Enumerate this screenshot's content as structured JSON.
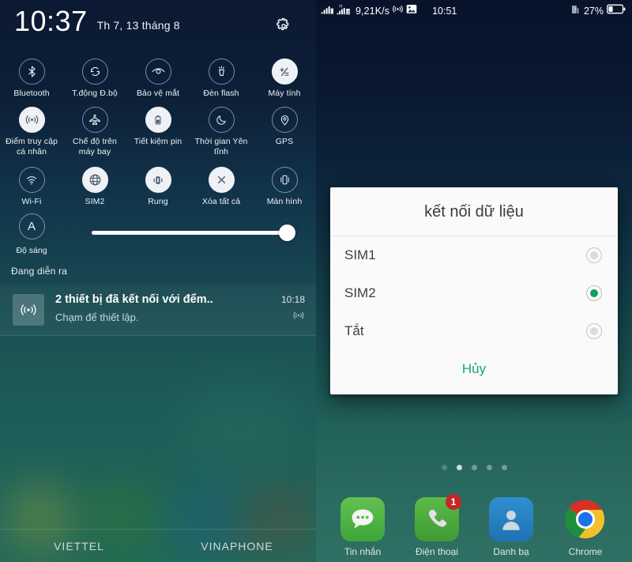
{
  "left_panel": {
    "clock": {
      "time": "10:37",
      "date": "Th 7, 13 tháng 8"
    },
    "settings_icon": "gear-icon",
    "quick_settings": [
      {
        "label": "Bluetooth",
        "icon": "bluetooth-icon",
        "active": false
      },
      {
        "label": "T.động Đ.bộ",
        "icon": "sync-icon",
        "active": false
      },
      {
        "label": "Bảo vệ mắt",
        "icon": "eye-icon",
        "active": false
      },
      {
        "label": "Đèn flash",
        "icon": "flashlight-icon",
        "active": false
      },
      {
        "label": "Máy tính",
        "icon": "calculator-icon",
        "active": true
      },
      {
        "label": "Điểm truy cập cá nhân",
        "icon": "hotspot-icon",
        "active": true
      },
      {
        "label": "Chế độ trên máy bay",
        "icon": "airplane-icon",
        "active": false
      },
      {
        "label": "Tiết kiệm pin",
        "icon": "battery-icon",
        "active": true
      },
      {
        "label": "Thời gian Yên tĩnh",
        "icon": "moon-icon",
        "active": false
      },
      {
        "label": "GPS",
        "icon": "location-pin-icon",
        "active": false
      },
      {
        "label": "Wi-Fi",
        "icon": "wifi-icon",
        "active": false
      },
      {
        "label": "SIM2",
        "icon": "globe-icon",
        "active": true
      },
      {
        "label": "Rung",
        "icon": "vibrate-icon",
        "active": true
      },
      {
        "label": "Xóa tất cả",
        "icon": "close-x-icon",
        "active": true
      },
      {
        "label": "Màn hình",
        "icon": "rotate-screen-icon",
        "active": false
      }
    ],
    "brightness": {
      "auto_letter": "A",
      "label": "Độ sáng",
      "value": 96
    },
    "ongoing_label": "Đang diễn ra",
    "notification": {
      "icon": "hotspot-icon",
      "title": "2 thiết bị đã kết nối với đểm..",
      "subtitle": "Chạm để thiết lập.",
      "time": "10:18",
      "badge_icon": "hotspot-icon"
    },
    "carriers": [
      "VIETTEL",
      "VINAPHONE"
    ]
  },
  "right_panel": {
    "status_bar": {
      "signal1_icon": "signal-bars-icon",
      "signal2_icon": "signal-bars-h-icon",
      "data_speed": "9,21K/s",
      "hotspot_icon": "hotspot-icon",
      "screenshot_icon": "image-icon",
      "clock": "10:51",
      "sim_battery_icon": "sim-battery-icon",
      "battery_percent": "27%",
      "battery_icon": "battery-icon"
    },
    "dialog": {
      "title": "kết nối dữ liệu",
      "options": [
        {
          "label": "SIM1",
          "selected": false
        },
        {
          "label": "SIM2",
          "selected": true
        },
        {
          "label": "Tắt",
          "selected": false
        }
      ],
      "cancel_label": "Hủy",
      "accent_color": "#17a37f",
      "selected_color": "#14a05e"
    },
    "page_indicator": {
      "count": 5,
      "active_index": 1
    },
    "dock": [
      {
        "label": "Tin nhắn",
        "icon": "messages-icon",
        "badge": null
      },
      {
        "label": "Điện thoại",
        "icon": "phone-icon",
        "badge": "1"
      },
      {
        "label": "Danh bạ",
        "icon": "contacts-icon",
        "badge": null
      },
      {
        "label": "Chrome",
        "icon": "chrome-icon",
        "badge": null
      }
    ]
  }
}
